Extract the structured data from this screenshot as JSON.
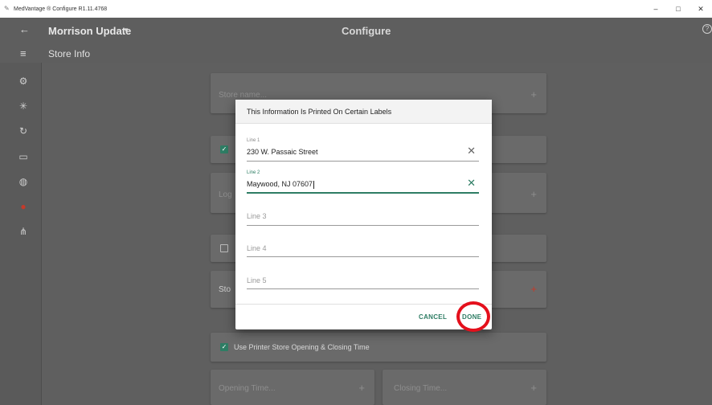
{
  "window": {
    "title": "MedVantage ® Configure R1.11.4768",
    "minimize": "–",
    "maximize": "□",
    "close": "✕"
  },
  "appbar": {
    "title": "Morrison Update",
    "page_title": "Configure",
    "section_title": "Store Info"
  },
  "sidebar": {
    "items": [
      {
        "icon": "settings-icon",
        "glyph": "⚙"
      },
      {
        "icon": "network-icon",
        "glyph": "✳"
      },
      {
        "icon": "refresh-icon",
        "glyph": "↻"
      },
      {
        "icon": "id-card-icon",
        "glyph": "▭"
      },
      {
        "icon": "globe-icon",
        "glyph": "◍"
      },
      {
        "icon": "location-pin-icon",
        "glyph": "●"
      },
      {
        "icon": "hierarchy-icon",
        "glyph": "⋔"
      }
    ]
  },
  "background": {
    "store_name_placeholder": "Store name...",
    "logo_placeholder": "Log",
    "store_placeholder": "Sto",
    "printer_hours_label": "Use Printer Store Opening & Closing Time",
    "opening_time_placeholder": "Opening Time...",
    "closing_time_placeholder": "Closing Time..."
  },
  "dialog": {
    "header": "This Information Is Printed On Certain Labels",
    "fields": [
      {
        "label": "Line 1",
        "value": "230 W. Passaic Street"
      },
      {
        "label": "Line 2",
        "value": "Maywood, NJ 07607"
      },
      {
        "placeholder": "Line 3"
      },
      {
        "placeholder": "Line 4"
      },
      {
        "placeholder": "Line 5"
      }
    ],
    "cancel_label": "CANCEL",
    "done_label": "DONE"
  },
  "colors": {
    "accent": "#2e7d64",
    "highlight_ring": "#e4101c",
    "active_icon": "#c43a2a"
  }
}
